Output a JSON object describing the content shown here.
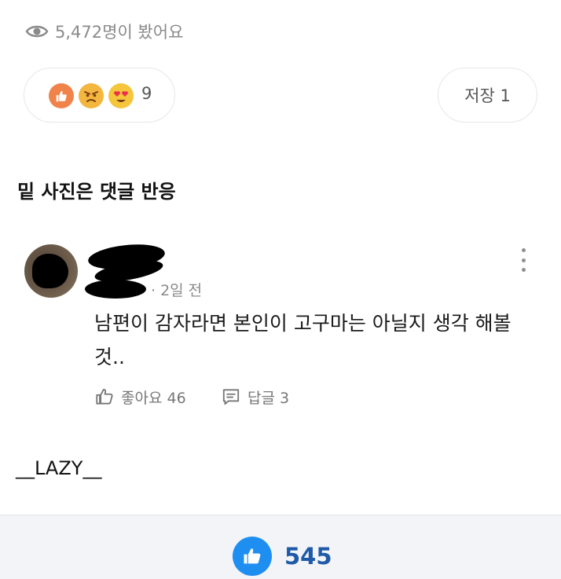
{
  "views": {
    "text": "5,472명이 봤어요",
    "icon": "eye-icon"
  },
  "reactions": {
    "count": "9",
    "items": [
      {
        "icon": "thumbs-up-reaction-icon",
        "color": "#f0834a"
      },
      {
        "icon": "angry-face-icon",
        "color": "#f3b73f"
      },
      {
        "icon": "heart-eyes-icon",
        "color": "#f5c53c"
      }
    ]
  },
  "save": {
    "label": "저장 1"
  },
  "section_title": "밑 사진은 댓글 반응",
  "comment": {
    "time": "· 2일 전",
    "text": "남편이 감자라면 본인이 고구마는 아닐지 생각 해볼 것..",
    "like_label": "좋아요 46",
    "reply_label": "답글 3"
  },
  "footer_name": "__LAZY__",
  "bottom": {
    "like_count": "545",
    "accent": "#1f8ef1"
  }
}
